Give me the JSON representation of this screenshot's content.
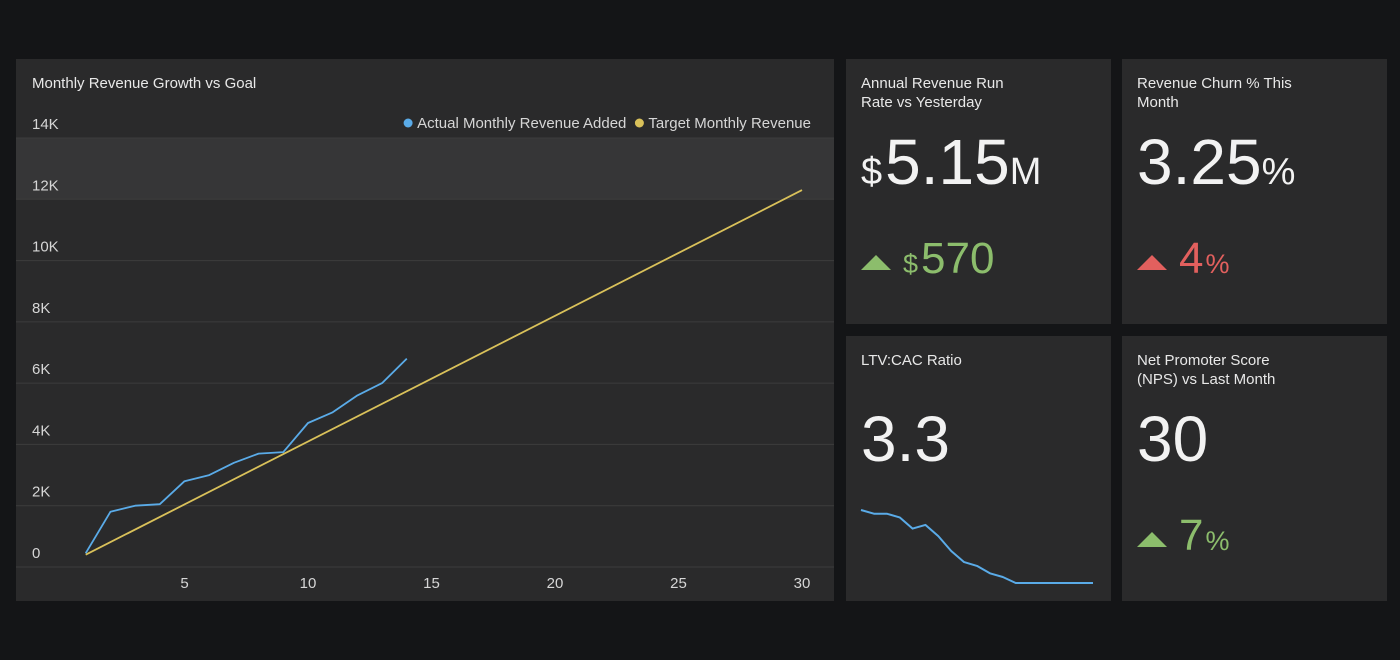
{
  "colors": {
    "background": "#141517",
    "card": "#2a2a2b",
    "actual_series": "#5aabe8",
    "target_series": "#d9c15a",
    "positive": "#8cbd6c",
    "negative": "#e2605e"
  },
  "revenue_chart": {
    "title": "Monthly Revenue Growth vs Goal",
    "legend": {
      "actual": "Actual Monthly Revenue Added",
      "target": "Target Monthly Revenue"
    }
  },
  "chart_data": {
    "type": "line",
    "title": "Monthly Revenue Growth vs Goal",
    "xlabel": "",
    "ylabel": "",
    "xlim": [
      1,
      30
    ],
    "ylim": [
      0,
      14000
    ],
    "x_ticks": [
      5,
      10,
      15,
      20,
      25,
      30
    ],
    "y_ticks": [
      0,
      2000,
      4000,
      6000,
      8000,
      10000,
      12000,
      14000
    ],
    "y_tick_labels": [
      "0",
      "2K",
      "4K",
      "6K",
      "8K",
      "10K",
      "12K",
      "14K"
    ],
    "highlight_band": [
      12000,
      14000
    ],
    "grid": true,
    "legend_position": "top-right",
    "series": [
      {
        "name": "Actual Monthly Revenue Added",
        "color": "#5aabe8",
        "x": [
          1,
          2,
          3,
          4,
          5,
          6,
          7,
          8,
          9,
          10,
          11,
          12,
          13,
          14
        ],
        "values": [
          450,
          1800,
          2000,
          2050,
          2800,
          3000,
          3400,
          3700,
          3750,
          4700,
          5050,
          5600,
          6000,
          6800
        ]
      },
      {
        "name": "Target Monthly Revenue",
        "color": "#d9c15a",
        "x": [
          1,
          30
        ],
        "values": [
          400,
          12300
        ]
      }
    ]
  },
  "arr_card": {
    "title": "Annual Revenue Run Rate vs Yesterday",
    "prefix": "$",
    "value": "5.15",
    "unit": "M",
    "delta_prefix": "$",
    "delta_value": "570",
    "delta_direction": "up"
  },
  "churn_card": {
    "title": "Revenue Churn % This Month",
    "value": "3.25",
    "unit": "%",
    "delta_value": "4",
    "delta_unit": "%",
    "delta_direction": "up"
  },
  "ltv_card": {
    "title": "LTV:CAC Ratio",
    "value": "3.3",
    "sparkline": [
      3.7,
      3.65,
      3.65,
      3.6,
      3.45,
      3.5,
      3.35,
      3.15,
      3.0,
      2.95,
      2.85,
      2.8,
      2.72,
      2.72,
      2.72,
      2.72,
      2.72,
      2.72,
      2.72
    ]
  },
  "nps_card": {
    "title": "Net Promoter Score (NPS) vs Last Month",
    "value": "30",
    "delta_value": "7",
    "delta_unit": "%",
    "delta_direction": "up"
  }
}
